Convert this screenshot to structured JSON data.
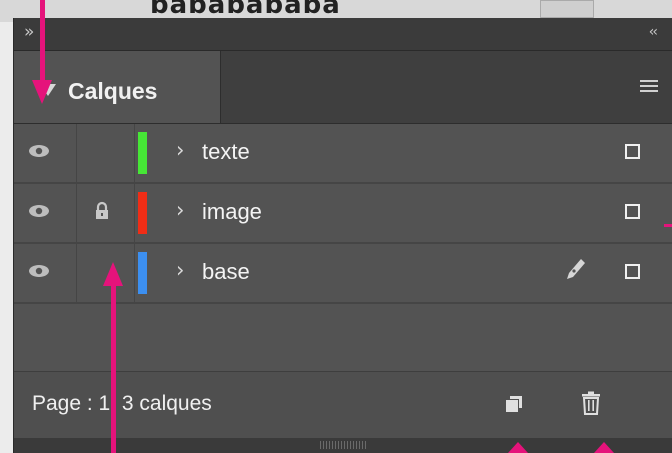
{
  "background": {
    "partial_text": "bababababa"
  },
  "panel": {
    "collapse_left_glyph": "»",
    "collapse_right_glyph": "‹‹",
    "tab_title": "Calques"
  },
  "layers": [
    {
      "name": "texte",
      "color": "#46e636",
      "visible": true,
      "locked": false,
      "has_pen": false
    },
    {
      "name": "image",
      "color": "#f02d16",
      "visible": true,
      "locked": true,
      "has_pen": false
    },
    {
      "name": "base",
      "color": "#3c8ff0",
      "visible": true,
      "locked": false,
      "has_pen": true
    }
  ],
  "footer": {
    "status": "Page : 1, 3 calques"
  },
  "colors": {
    "annotation_arrow": "#e5137b",
    "panel_bg": "#535353"
  },
  "icons": [
    "eye-icon",
    "lock-icon",
    "chevron-right-icon",
    "pen-icon",
    "new-layer-icon",
    "trash-icon",
    "panel-menu-icon",
    "tab-arrow-icon"
  ]
}
